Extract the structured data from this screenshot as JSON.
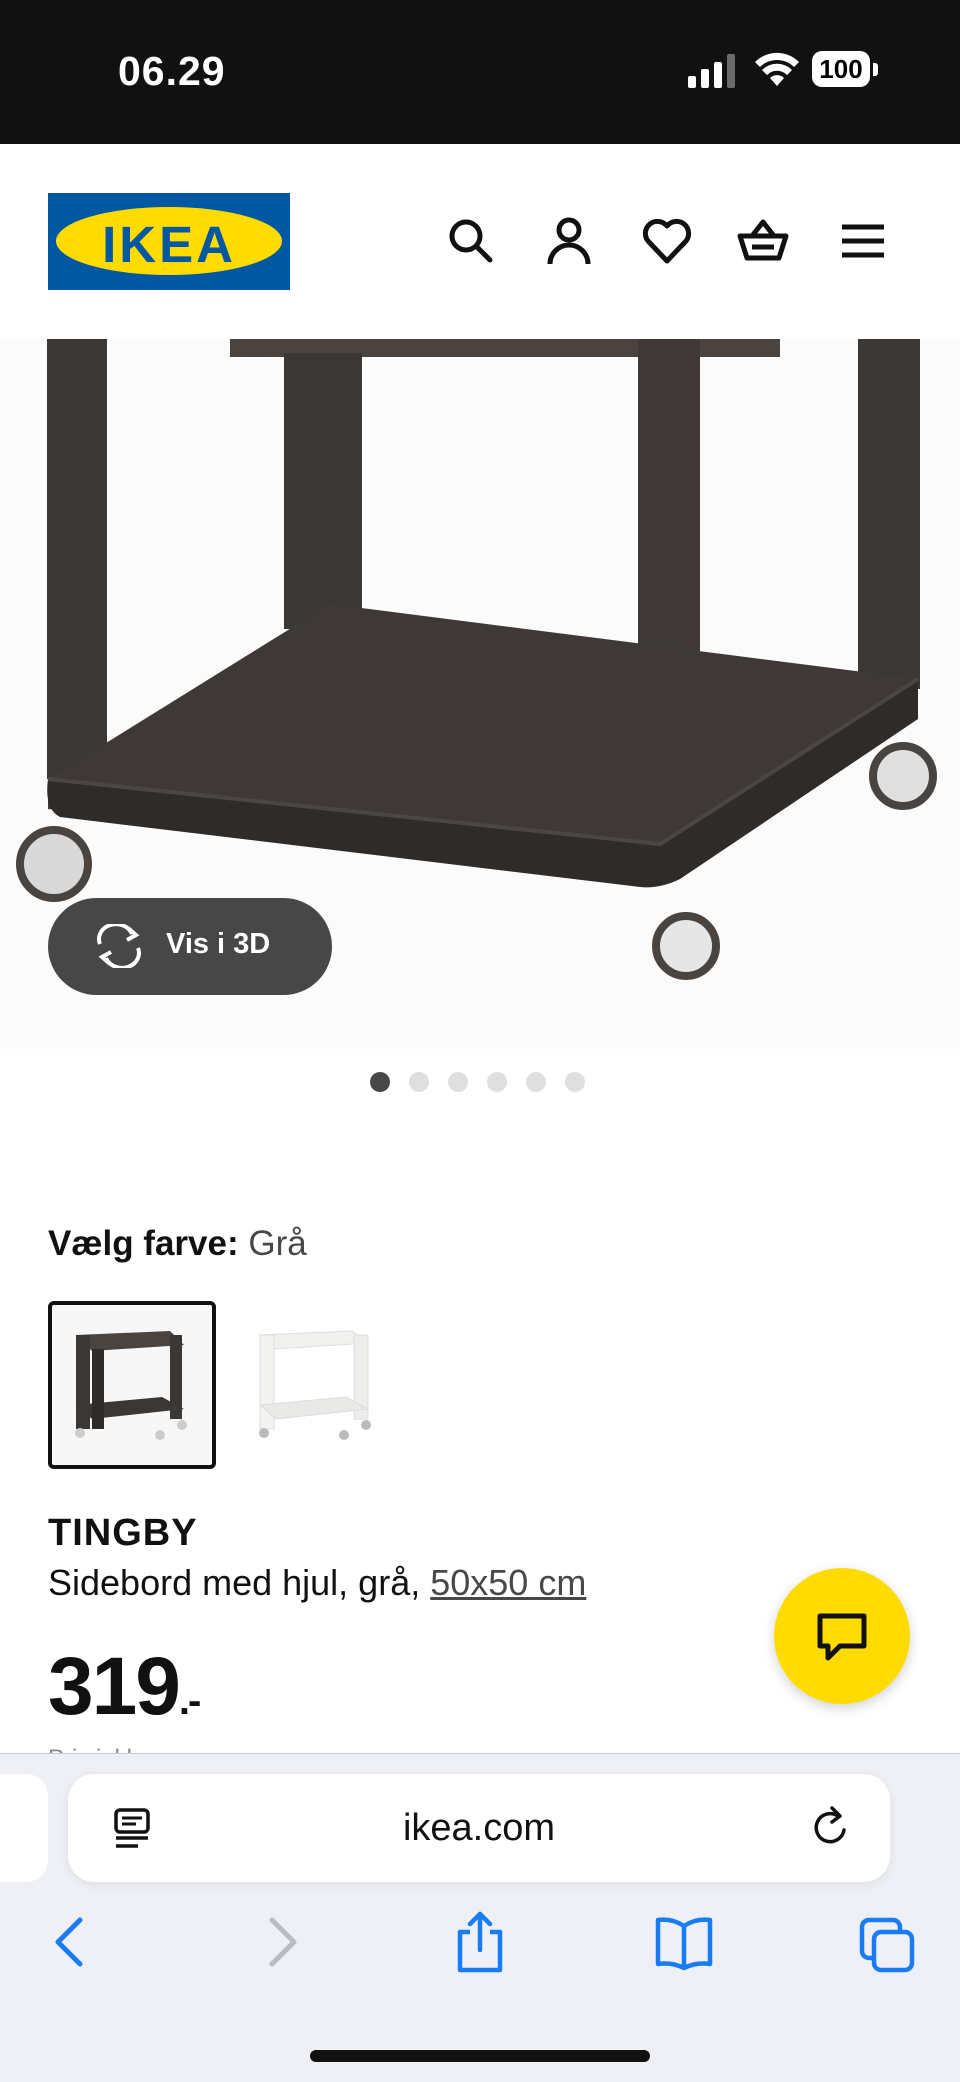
{
  "status_bar": {
    "time": "06.29",
    "battery": "100",
    "icons": [
      "cellular-signal-icon",
      "wifi-icon",
      "battery-icon"
    ]
  },
  "header": {
    "logo_text": "IKEA",
    "icons": [
      "search-icon",
      "account-icon",
      "heart-icon",
      "basket-icon",
      "menu-icon"
    ]
  },
  "gallery": {
    "view_3d_label": "Vis i 3D",
    "slide_count": 6,
    "active_slide": 1
  },
  "color_picker": {
    "label": "Vælg farve:",
    "selected": "Grå",
    "options": [
      "gray-side-table",
      "white-side-table"
    ]
  },
  "product": {
    "name": "TINGBY",
    "description": "Sidebord med hjul, grå,",
    "size": "50x50 cm",
    "price": "319",
    "price_suffix": ".-",
    "cut_line": "Pris inkl. moms"
  },
  "browser": {
    "url": "ikea.com",
    "toolbar": [
      "back-icon",
      "forward-icon",
      "share-icon",
      "bookmarks-icon",
      "tabs-icon"
    ]
  },
  "colors": {
    "ikea_blue": "#0058A3",
    "ikea_yellow": "#FFDB00",
    "safari_blue": "#1a7cf5",
    "product_dark": "#3b3734"
  }
}
